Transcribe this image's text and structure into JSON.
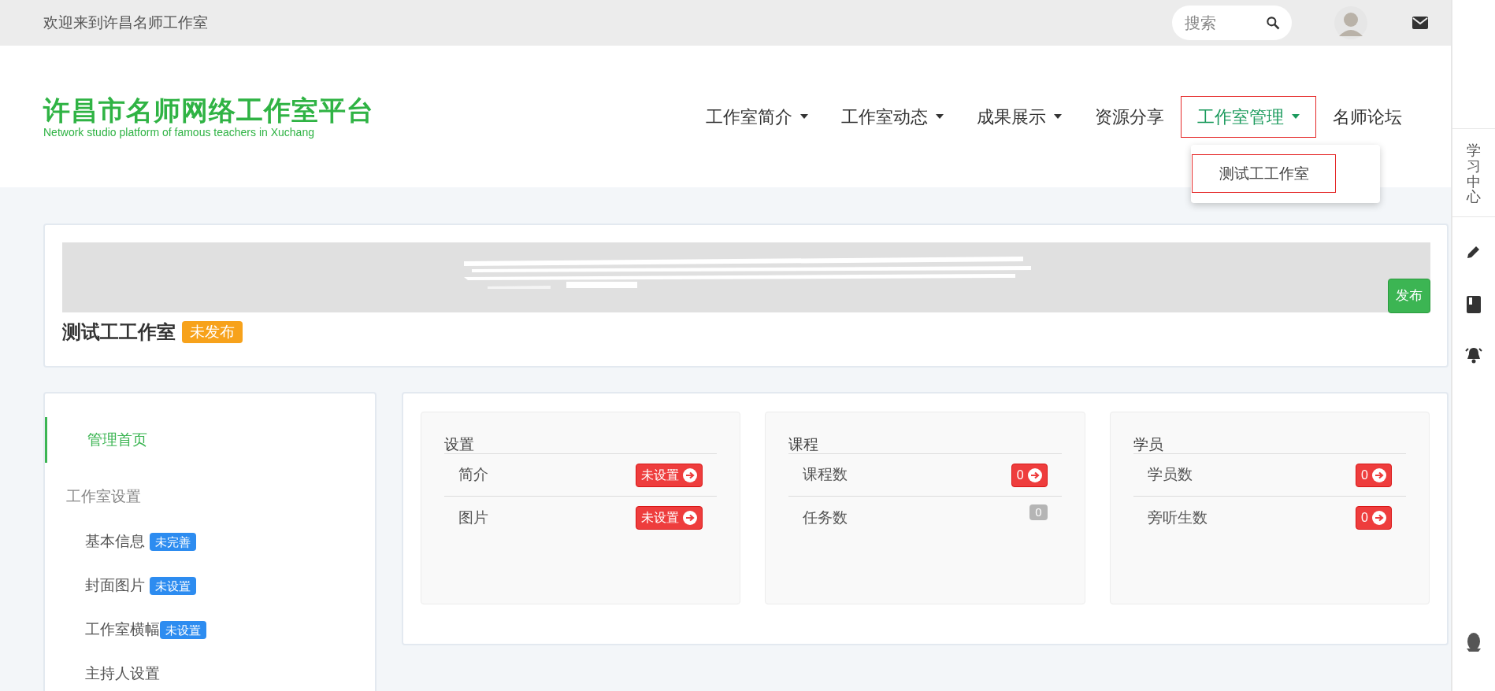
{
  "top_bar": {
    "welcome": "欢迎来到许昌名师工作室",
    "search": {
      "placeholder": "搜索"
    }
  },
  "logo": {
    "title": "许昌市名师网络工作室平台",
    "subtitle": "Network studio platform of famous teachers in Xuchang"
  },
  "nav": [
    {
      "label": "工作室简介",
      "dropdown": true,
      "selected": false
    },
    {
      "label": "工作室动态",
      "dropdown": true,
      "selected": false
    },
    {
      "label": "成果展示",
      "dropdown": true,
      "selected": false
    },
    {
      "label": "资源分享",
      "dropdown": false,
      "selected": false
    },
    {
      "label": "工作室管理",
      "dropdown": true,
      "selected": true
    },
    {
      "label": "名师论坛",
      "dropdown": false,
      "selected": false
    }
  ],
  "dropdown_menu": [
    {
      "label": "测试工工作室",
      "selected": true
    }
  ],
  "studio": {
    "title": "测试工工作室",
    "status": "未发布",
    "publish_button": "发布"
  },
  "sidebar": [
    {
      "label": "管理首页",
      "selected": true
    },
    {
      "label": "工作室设置",
      "selected": false,
      "children": [
        {
          "label": "基本信息",
          "badge": "未完善",
          "selected": false
        },
        {
          "label": "封面图片",
          "badge": "未设置",
          "selected": false
        },
        {
          "label": "工作室横幅",
          "badge": "未设置",
          "selected": false
        },
        {
          "label": "主持人设置",
          "selected": false
        }
      ]
    }
  ],
  "panels": [
    {
      "title": "设置",
      "rows": [
        {
          "label": "简介",
          "value": "未设置",
          "kind": "alert"
        },
        {
          "label": "图片",
          "value": "未设置",
          "kind": "alert"
        }
      ]
    },
    {
      "title": "课程",
      "rows": [
        {
          "label": "课程数",
          "value": "0",
          "kind": "alert"
        },
        {
          "label": "任务数",
          "value": "0",
          "kind": "muted"
        }
      ]
    },
    {
      "title": "学员",
      "rows": [
        {
          "label": "学员数",
          "value": "0",
          "kind": "alert"
        },
        {
          "label": "旁听生数",
          "value": "0",
          "kind": "alert"
        }
      ]
    }
  ],
  "right_rail": {
    "label": "学习中心"
  }
}
